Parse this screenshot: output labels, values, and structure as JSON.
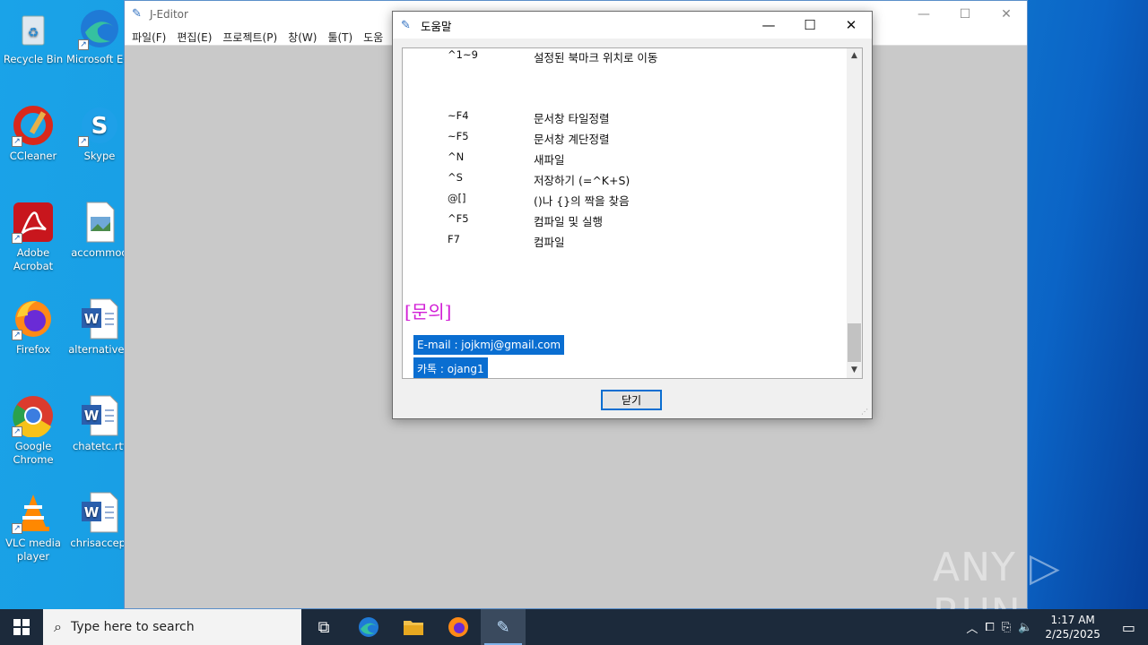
{
  "desktop": {
    "icons": [
      {
        "label": "Recycle Bin",
        "icon": "recycle-bin-icon"
      },
      {
        "label": "Microsoft Edge",
        "icon": "edge-icon"
      },
      {
        "label": "CCleaner",
        "icon": "ccleaner-icon"
      },
      {
        "label": "Skype",
        "icon": "skype-icon"
      },
      {
        "label": "Adobe Acrobat",
        "icon": "acrobat-icon"
      },
      {
        "label": "accommod",
        "icon": "image-file-icon"
      },
      {
        "label": "Firefox",
        "icon": "firefox-icon"
      },
      {
        "label": "alternativeu",
        "icon": "word-doc-icon"
      },
      {
        "label": "Google Chrome",
        "icon": "chrome-icon"
      },
      {
        "label": "chatetc.rtf",
        "icon": "word-doc-icon"
      },
      {
        "label": "VLC media player",
        "icon": "vlc-icon"
      },
      {
        "label": "chrisaccep.",
        "icon": "word-doc-icon"
      }
    ]
  },
  "jeditor": {
    "title": "J-Editor",
    "menu": [
      "파일(F)",
      "편집(E)",
      "프로젝트(P)",
      "창(W)",
      "툴(T)",
      "도움"
    ]
  },
  "help_dialog": {
    "title": "도움말",
    "rows": [
      {
        "key": "^1~9",
        "desc": "설정된 북마크 위치로 이동"
      },
      {
        "key": "~F4",
        "desc": "문서창 타일정렬"
      },
      {
        "key": "~F5",
        "desc": "문서창 계단정렬"
      },
      {
        "key": "^N",
        "desc": "새파일"
      },
      {
        "key": "^S",
        "desc": "저장하기 (=^K+S)"
      },
      {
        "key": "@[]",
        "desc": "()나 {}의 짝을 찾음"
      },
      {
        "key": "^F5",
        "desc": "컴파일 및 실행"
      },
      {
        "key": "F7",
        "desc": "컴파일"
      }
    ],
    "heading": "[문의]",
    "email": "E-mail : jojkmj@gmail.com",
    "kakao": "카톡 : ojang1",
    "close_button": "닫기"
  },
  "watermark": "ANY ▷ RUN",
  "taskbar": {
    "search_placeholder": "Type here to search",
    "time": "1:17 AM",
    "date": "2/25/2025"
  },
  "colors": {
    "selection": "#0a6ed1",
    "heading": "#d21fd6",
    "taskbar": "#1c2a3b"
  }
}
